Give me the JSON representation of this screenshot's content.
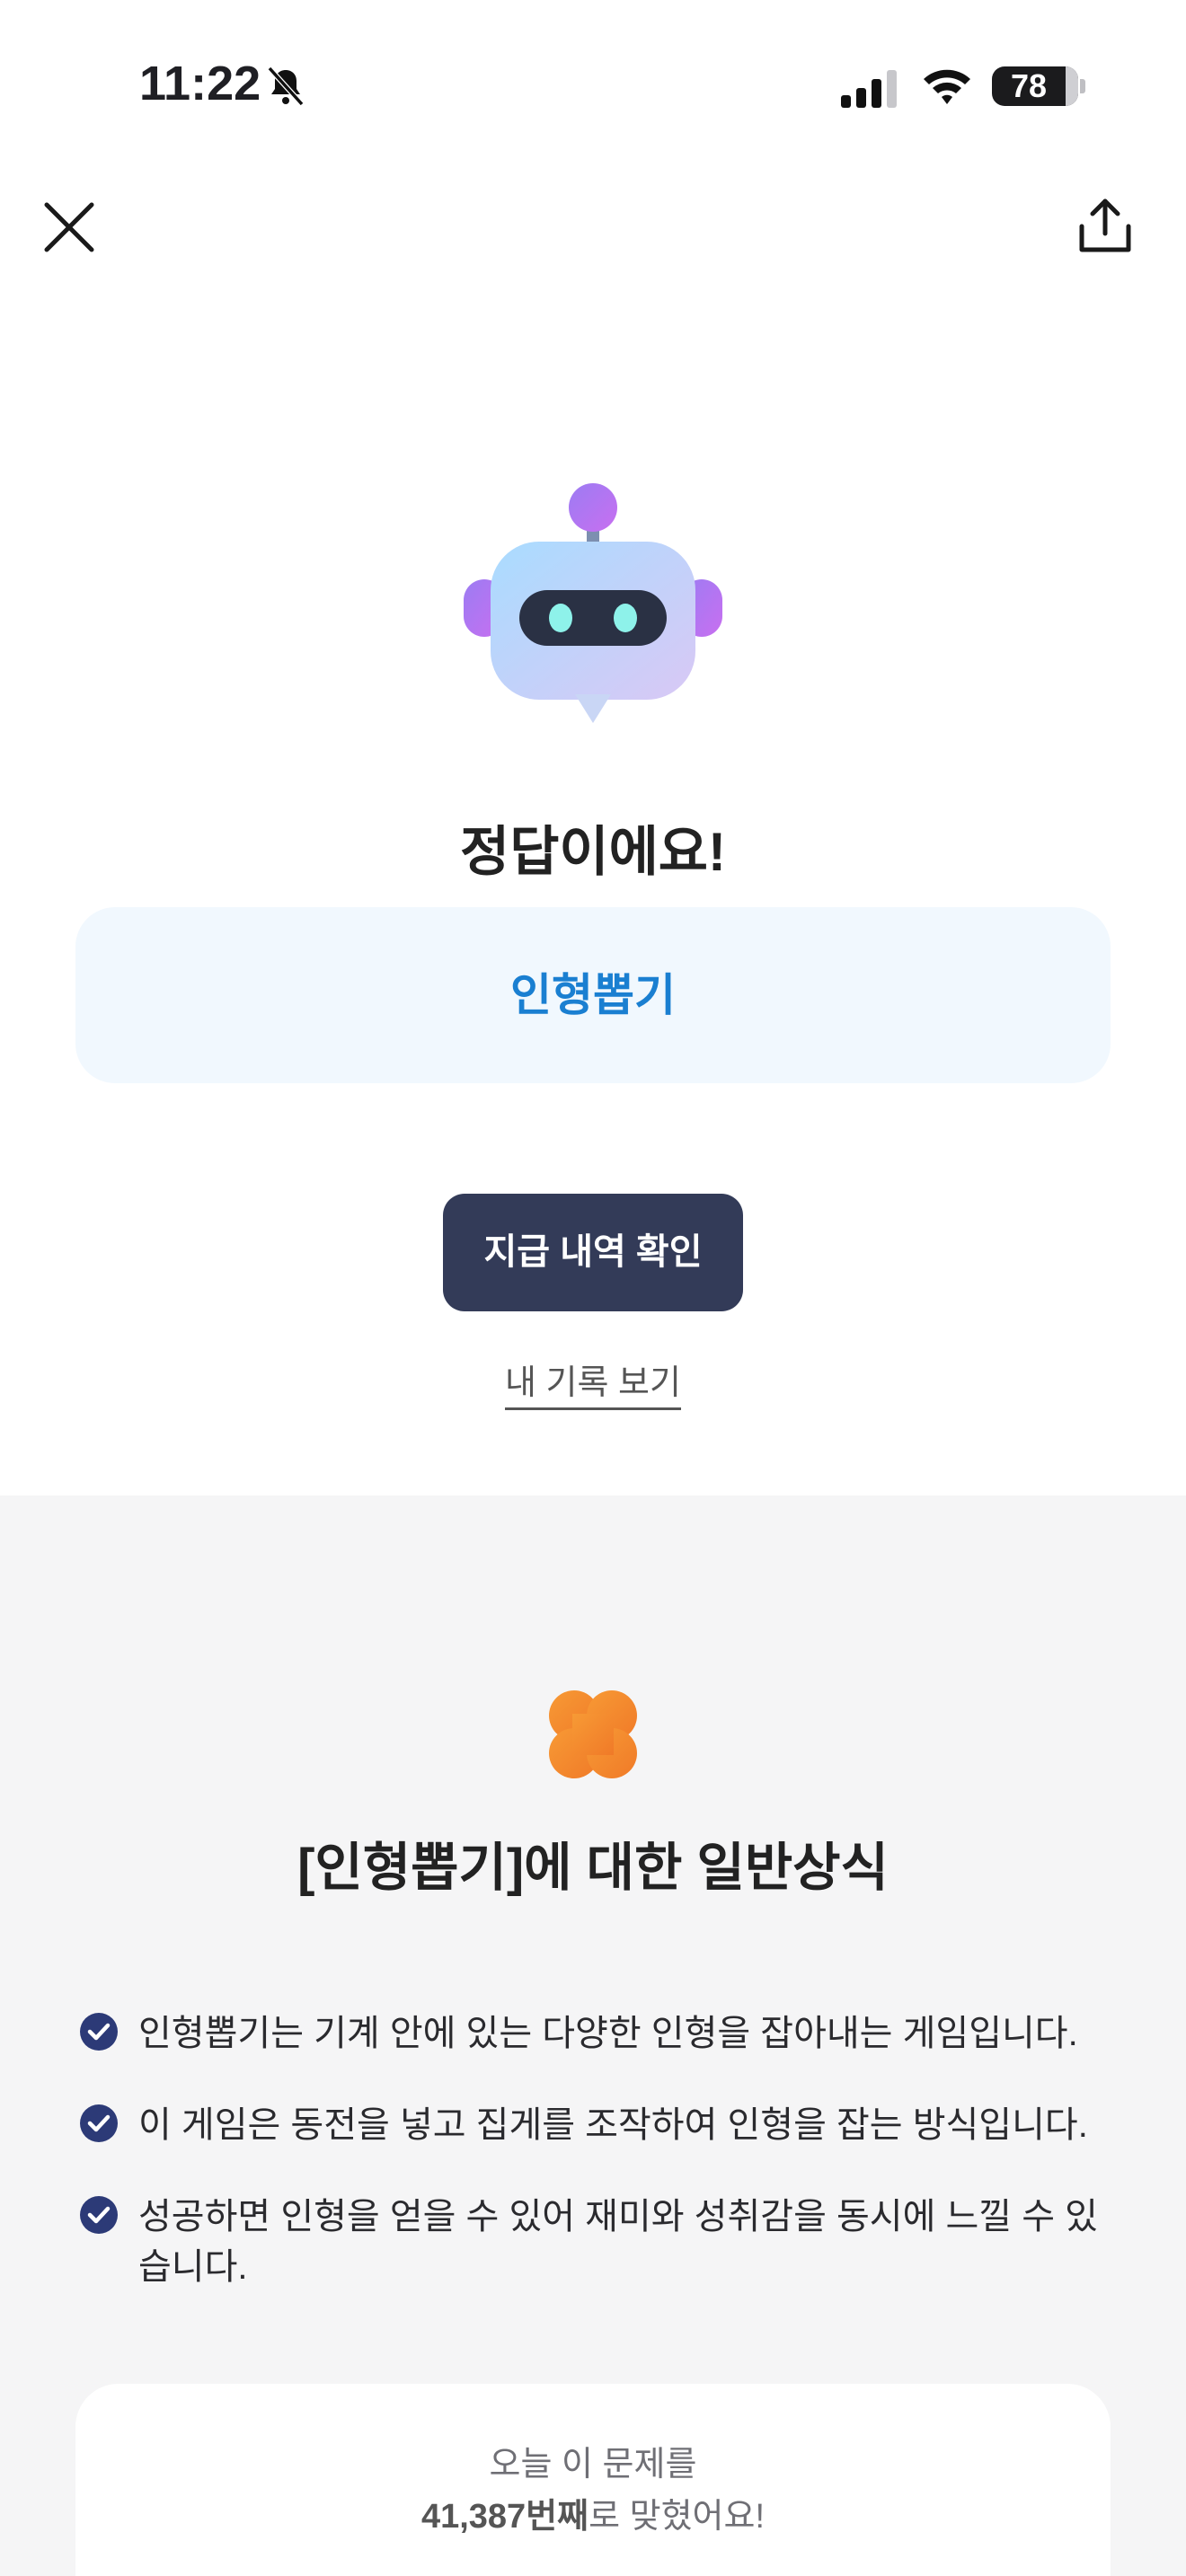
{
  "status_bar": {
    "time": "11:22",
    "battery": "78"
  },
  "result": {
    "title": "정답이에요!",
    "answer": "인형뽑기",
    "primary_button": "지급 내역 확인",
    "records_link": "내 기록 보기"
  },
  "trivia": {
    "title": "[인형뽑기]에 대한 일반상식",
    "facts": [
      "인형뽑기는 기계 안에 있는 다양한 인형을 잡아내는 게임입니다.",
      "이 게임은 동전을 넣고 집게를 조작하여 인형을 잡는 방식입니다.",
      "성공하면 인형을 얻을 수 있어 재미와 성취감을 동시에 느낄 수 있",
      "습니다."
    ]
  },
  "stats": {
    "line1": "오늘 이 문제를",
    "count": "41,387번째",
    "suffix": "로 맞혔어요!"
  },
  "colors": {
    "accent_blue": "#1a7fd1",
    "button_navy": "#333b58",
    "check_navy": "#2c3a77",
    "clover_orange": "#f48a2c"
  }
}
